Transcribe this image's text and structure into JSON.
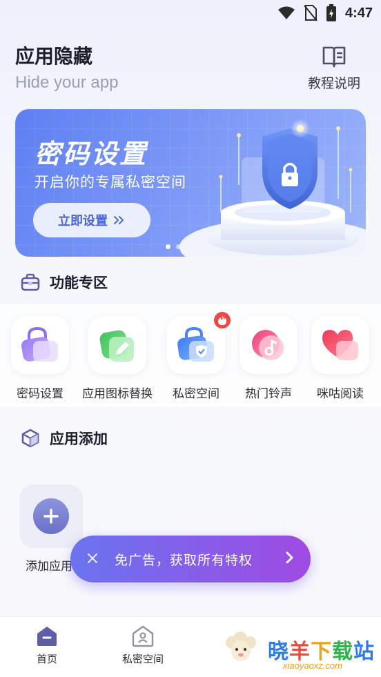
{
  "status_bar": {
    "time": "4:47",
    "icons": [
      "wifi-icon",
      "no-sim-icon",
      "battery-charging-icon"
    ]
  },
  "header": {
    "title": "应用隐藏",
    "subtitle": "Hide your app",
    "tutorial_label": "教程说明",
    "tutorial_icon": "book-icon"
  },
  "banner": {
    "title": "密码设置",
    "subtitle": "开启你的专属私密空间",
    "button_label": "立即设置",
    "button_icon": "double-chevron-right-icon",
    "page_count": 2,
    "active_page": 1
  },
  "features": {
    "title": "功能专区",
    "icon": "toolbox-icon",
    "items": [
      {
        "label": "密码设置",
        "icon": "lock-bag-icon"
      },
      {
        "label": "应用图标替换",
        "icon": "edit-pencil-icon"
      },
      {
        "label": "私密空间",
        "icon": "shield-bag-icon",
        "badge": "fire-icon"
      },
      {
        "label": "热门铃声",
        "icon": "music-note-icon"
      },
      {
        "label": "咪咕阅读",
        "icon": "heart-icon"
      }
    ]
  },
  "app_add": {
    "title": "应用添加",
    "icon": "cube-icon",
    "add_label": "添加应用"
  },
  "promo": {
    "text": "免广告，获取所有特权",
    "close_icon": "close-icon",
    "arrow_icon": "chevron-right-icon"
  },
  "bottom_nav": {
    "items": [
      {
        "label": "首页",
        "icon": "home-icon",
        "active": true
      },
      {
        "label": "私密空间",
        "icon": "house-lock-icon",
        "active": false
      }
    ]
  },
  "watermark": {
    "text": "晓羊下载站",
    "url": "xiaoyaoxz.com"
  },
  "colors": {
    "accent": "#5d7ff2",
    "promo_start": "#6a74f0",
    "promo_end": "#a04be3",
    "hot_badge": "#f04848"
  }
}
